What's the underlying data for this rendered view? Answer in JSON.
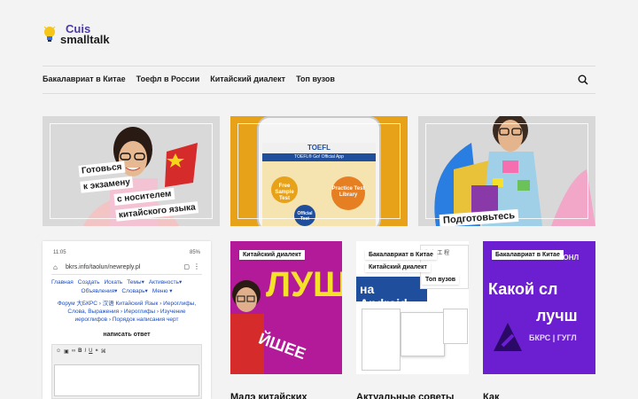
{
  "logo": {
    "line1": "Cuis",
    "line2": "smalltalk"
  },
  "nav": {
    "items": [
      "Бакалавриат в Китае",
      "Тоефл в России",
      "Китайский диалект",
      "Топ вузов"
    ]
  },
  "hero_cards": [
    {
      "caption_lines": [
        "Готовься",
        "к экзамену",
        "с носителем",
        "китайского языка"
      ]
    },
    {
      "app_title": "TOEFL",
      "app_subtitle": "TOEFL® Go! Official App",
      "bubbles": [
        "Free Sample Test",
        "Practice Test Library",
        "Official Test"
      ]
    },
    {
      "caption": "Подготовьтесь"
    }
  ],
  "phone_card": {
    "status_time": "11:05",
    "status_battery": "85%",
    "url": "bkrs.info/taolun/newreply.pl",
    "menu_row1": [
      "Главная",
      "Создать",
      "Искать",
      "Темы▾",
      "Активность▾"
    ],
    "menu_row2": [
      "Объявления▾",
      "Словарь▾",
      "Меню ▾"
    ],
    "breadcrumb": "Форум 大БКРС › 汉语 Китайский Язык › Иероглифы, Слова, Выражения › Иероглифы › Изучение иероглифов › Порядок написания черт",
    "reply_title": "написать ответ"
  },
  "small_cards": [
    {
      "badges": [
        "Китайский диалект"
      ],
      "image_text": "ЛУЧШ",
      "heading": "Малэ китайских"
    },
    {
      "badges": [
        "Бакалавриат в Китае",
        "Китайский диалект",
        "Топ вузов"
      ],
      "image_text": "на Android",
      "heading": "Актуальные советы"
    },
    {
      "badges": [
        "Бакалавриат в Китае"
      ],
      "image_text_top": "КИТАЙСКИЕ ОНЛ",
      "image_text_main": "Какой сл",
      "image_text_sub": "лучш",
      "image_text_brand": "БКРС | ГУГЛ",
      "heading": "Как"
    }
  ],
  "colors": {
    "accent": "#4a3aa8",
    "orange": "#e8a21a",
    "purple": "#6c1fd0",
    "magenta": "#c51fa8"
  }
}
